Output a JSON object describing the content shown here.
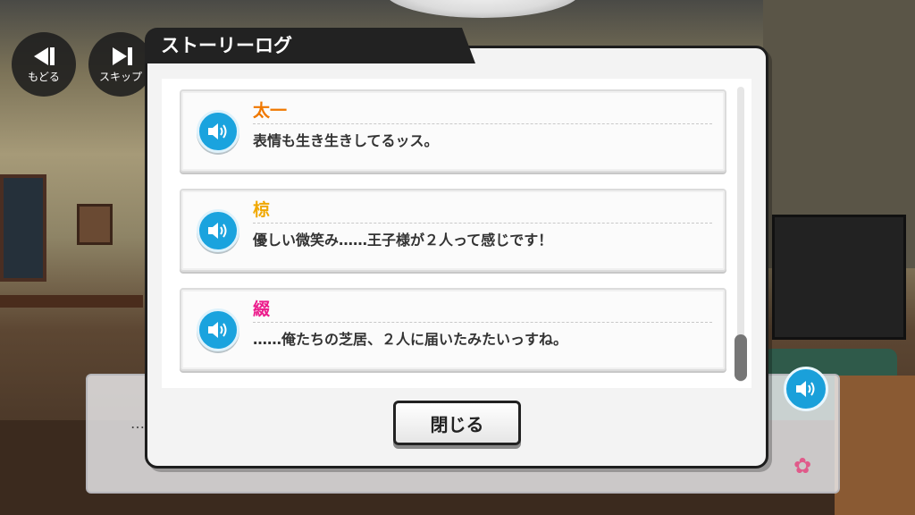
{
  "controls": {
    "back_label": "もどる",
    "skip_label": "スキップ"
  },
  "dialog": {
    "title": "ストーリーログ",
    "close_label": "閉じる"
  },
  "log_entries": [
    {
      "speaker": "太一",
      "speaker_color": "#f07800",
      "text": "表情も生き生きしてるッス。"
    },
    {
      "speaker": "椋",
      "speaker_color": "#f0a800",
      "text": "優しい微笑み……王子様が２人って感じです！"
    },
    {
      "speaker": "綴",
      "speaker_color": "#ec1c8c",
      "text": "……俺たちの芝居、２人に届いたみたいっすね。"
    }
  ],
  "message_box": {
    "text": "…"
  },
  "icons": {
    "back": "rewind-icon",
    "skip": "skip-icon",
    "voice": "speaker-icon",
    "flower": "flower-icon"
  },
  "colors": {
    "voice_button": "#1aa3de",
    "panel_border": "#1d1d1d"
  }
}
